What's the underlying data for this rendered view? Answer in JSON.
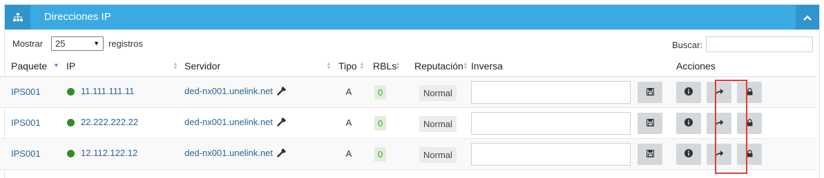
{
  "panel": {
    "title": "Direcciones IP"
  },
  "controls": {
    "show_label": "Mostrar",
    "show_value": "25",
    "show_after": "registros",
    "search_label": "Buscar:",
    "search_value": ""
  },
  "table": {
    "headers": {
      "paquete": "Paquete",
      "ip": "IP",
      "servidor": "Servidor",
      "tipo": "Tipo",
      "rbls": "RBLs",
      "reputacion": "Reputación",
      "inversa": "Inversa",
      "acciones": "Acciones"
    },
    "rows": [
      {
        "paquete": "IPS001",
        "ip": "11.111.111.11",
        "servidor": "ded-nx001.unelink.net",
        "tipo": "A",
        "rbls": "0",
        "reputacion": "Normal",
        "inversa": ""
      },
      {
        "paquete": "IPS001",
        "ip": "22.222.222.22",
        "servidor": "ded-nx001.unelink.net",
        "tipo": "A",
        "rbls": "0",
        "reputacion": "Normal",
        "inversa": ""
      },
      {
        "paquete": "IPS001",
        "ip": "12.112.122.12",
        "servidor": "ded-nx001.unelink.net",
        "tipo": "A",
        "rbls": "0",
        "reputacion": "Normal",
        "inversa": ""
      }
    ]
  },
  "colors": {
    "header_bg": "#3baae3",
    "header_icon_bg": "#2f95cc",
    "status_dot": "#2f8d2a",
    "highlight": "#e53935"
  },
  "icons": {
    "panel": "sitemap-icon",
    "collapse": "chevron-up-icon",
    "wrench": "wrench-icon",
    "save": "floppy-disk-icon",
    "info": "info-circle-icon",
    "forward": "share-arrow-icon",
    "lock": "lock-icon"
  }
}
